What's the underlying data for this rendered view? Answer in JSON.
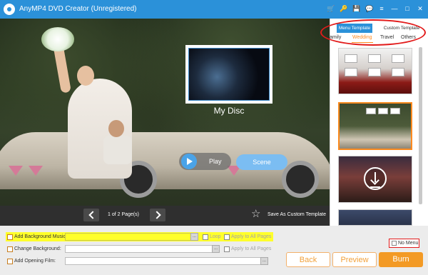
{
  "window": {
    "title": "AnyMP4 DVD Creator (Unregistered)"
  },
  "titlebar_icons": [
    "cart-icon",
    "pin-icon",
    "save-icon",
    "chat-icon",
    "menu-icon",
    "minimize-icon",
    "maximize-icon",
    "close-icon"
  ],
  "titlebar_glyphs": [
    "🛒",
    "🔑",
    "💾",
    "💬",
    "≡",
    "—",
    "□",
    "✕"
  ],
  "preview": {
    "disc_title": "My Disc",
    "play_label": "Play",
    "scene_label": "Scene",
    "page_indicator": "1 of 2 Page(s)",
    "save_custom_label": "Save As Custom Template",
    "star_glyph": "☆"
  },
  "template_panel": {
    "tabs": [
      {
        "label": "Menu Template",
        "active": true
      },
      {
        "label": "Custom Template",
        "active": false
      }
    ],
    "categories": [
      {
        "label": "amily",
        "active": false
      },
      {
        "label": "Wedding",
        "active": true
      },
      {
        "label": "Travel",
        "active": false
      },
      {
        "label": "Others",
        "active": false
      }
    ],
    "selected_index": 1
  },
  "settings": {
    "background_music": {
      "label": "Add Background Music:",
      "value": "",
      "browse": "...",
      "loop_label": "Loop",
      "apply_all_label": "Apply to All Pages"
    },
    "background": {
      "label": "Change Background:",
      "value": "",
      "browse": "...",
      "apply_all_label": "Apply to All Pages"
    },
    "opening_film": {
      "label": "Add Opening Film:",
      "value": "",
      "browse": "..."
    },
    "no_menu_label": "No Menu"
  },
  "buttons": {
    "back": "Back",
    "preview": "Preview",
    "burn": "Burn"
  },
  "colors": {
    "accent_blue": "#2b91d9",
    "accent_orange": "#f39a25",
    "highlight_yellow": "#ffff2b",
    "annotation_red": "#e21b1b"
  }
}
